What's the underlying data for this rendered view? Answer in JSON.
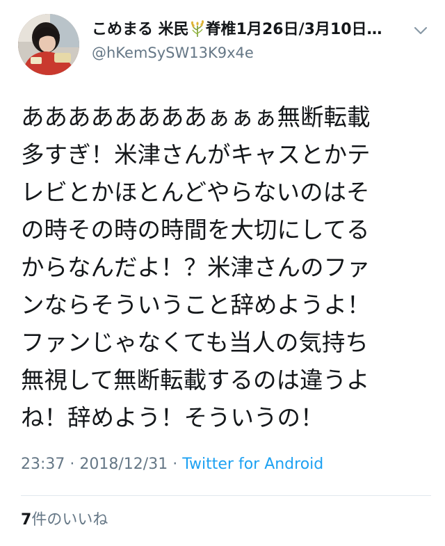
{
  "author": {
    "display_name_prefix": "こめまる 米民",
    "display_name_suffix": "脊椎1月26日/3月10日…",
    "handle": "@hKemSySW13K9x4e",
    "name_icon": "rice-plant-icon"
  },
  "tweet": {
    "text": "ああああああああぁぁぁ無断転載\n多すぎ！米津さんがキャスとかテ\nレビとかほとんどやらないのはそ\nの時その時の時間を大切にしてる\nからなんだよ！？米津さんのファ\nンならそういうこと辞めようよ！\nファンじゃなくても当人の気持ち\n無視して無断転載するのは違うよ\nね！辞めよう！そういうの！",
    "time": "23:37",
    "separator": "·",
    "date": "2018/12/31",
    "source": "Twitter for Android"
  },
  "likes": {
    "count": "7",
    "label": "件のいいね"
  },
  "colors": {
    "text": "#14171a",
    "secondary": "#657786",
    "link": "#1da1f2",
    "divider": "#e1e8ed"
  }
}
